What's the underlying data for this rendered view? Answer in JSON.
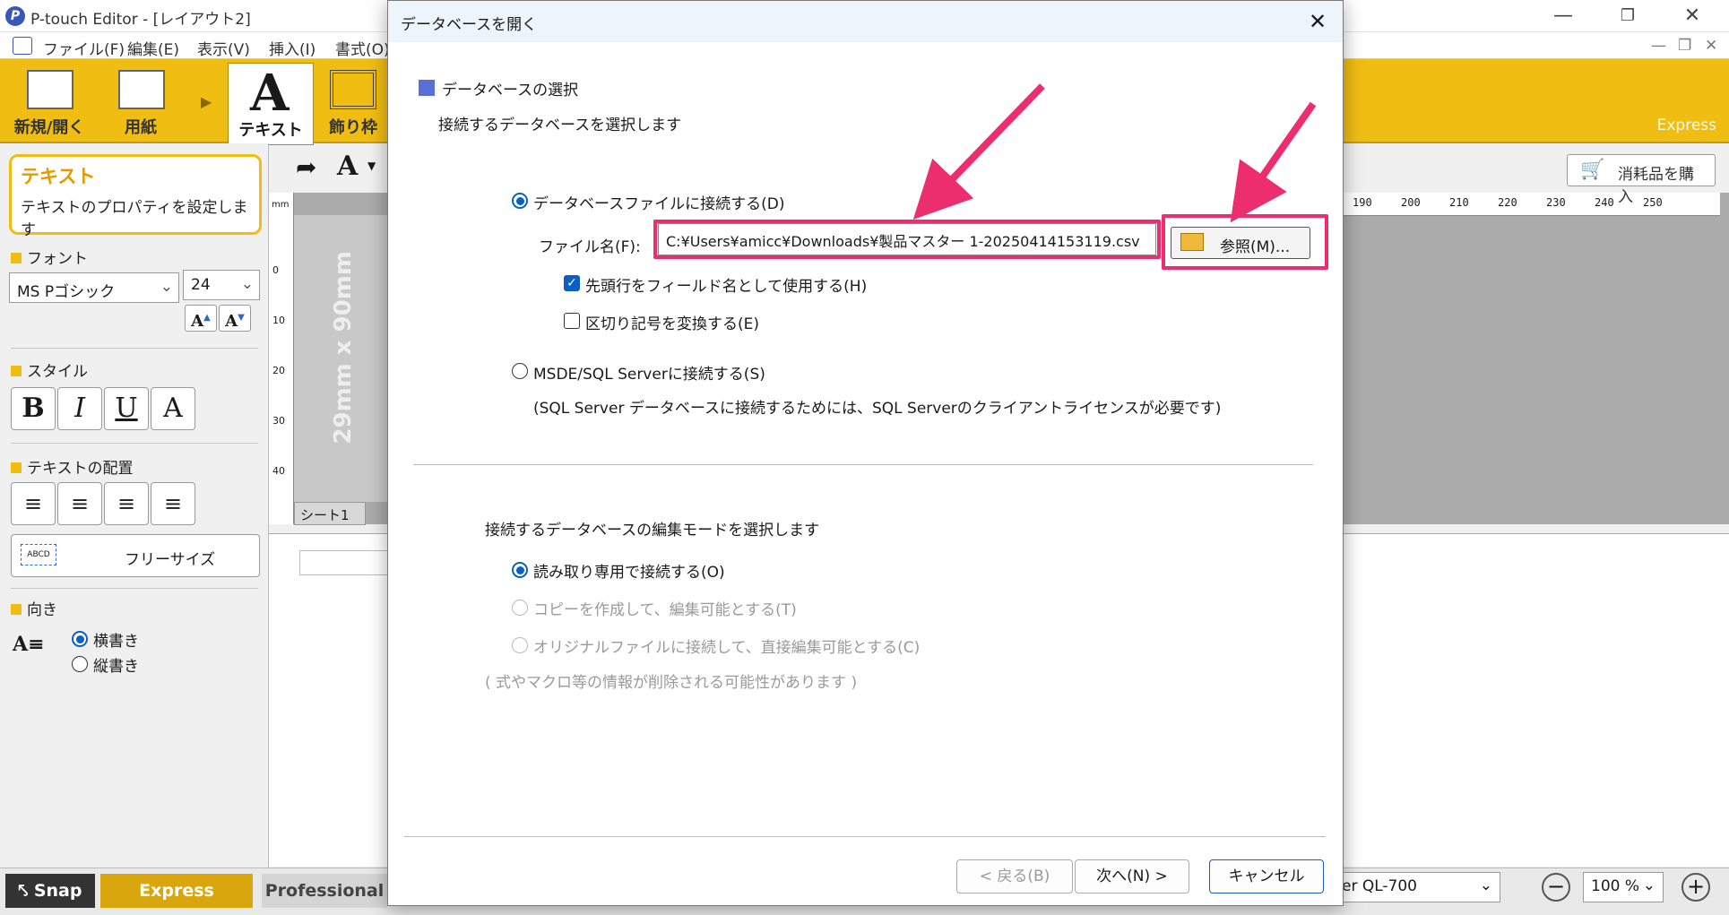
{
  "app": {
    "title": "P-touch Editor - [レイアウト2]",
    "logo": "P"
  },
  "menu": [
    "ファイル(F)",
    "編集(E)",
    "表示(V)",
    "挿入(I)",
    "書式(O)"
  ],
  "ribbon": {
    "new_open": "新規/開く",
    "paper": "用紙",
    "text": "テキスト",
    "frame": "飾り枠",
    "mode_label": "Express"
  },
  "left_panel": {
    "card_title": "テキスト",
    "card_desc": "テキストのプロパティを設定します",
    "font_section": "フォント",
    "font_name": "MS Pゴシック",
    "font_size": "24",
    "style_section": "スタイル",
    "align_section": "テキストの配置",
    "free_size": "フリーサイズ",
    "orientation_section": "向き",
    "horizontal": "横書き",
    "vertical": "縦書き"
  },
  "canvas": {
    "size_label": "29mm x 90mm",
    "sheet_tab": "シート1",
    "ruler_unit": "mm",
    "ruler_left_ticks": [
      "0",
      "10",
      "20",
      "30",
      "40"
    ],
    "ruler_top_ticks": [
      "190",
      "200",
      "210",
      "220",
      "230",
      "240",
      "250"
    ],
    "buy_label": "消耗品を購入"
  },
  "statusbar": {
    "snap": "Snap",
    "express": "Express",
    "professional": "Professional",
    "printer": "er QL-700",
    "zoom": "100 %"
  },
  "dialog": {
    "title": "データベースを開く",
    "section_title": "データベースの選択",
    "section_desc": "接続するデータベースを選択します",
    "opt_file": "データベースファイルに接続する(D)",
    "file_label": "ファイル名(F):",
    "file_value": "C:¥Users¥amicc¥Downloads¥製品マスター 1-20250414153119.csv",
    "browse_label": "参照(M)...",
    "chk_header": "先頭行をフィールド名として使用する(H)",
    "chk_delim": "区切り記号を変換する(E)",
    "opt_sql": "MSDE/SQL Serverに接続する(S)",
    "sql_note": "(SQL Server データベースに接続するためには、SQL Serverのクライアントライセンスが必要です)",
    "edit_mode_desc": "接続するデータベースの編集モードを選択します",
    "opt_readonly": "読み取り専用で接続する(O)",
    "opt_copy": "コピーを作成して、編集可能とする(T)",
    "opt_original": "オリジナルファイルに接続して、直接編集可能とする(C)",
    "macro_note": "( 式やマクロ等の情報が削除される可能性があります )",
    "back_btn": "< 戻る(B)",
    "next_btn": "次へ(N) >",
    "cancel_btn": "キャンセル"
  },
  "colors": {
    "ribbon": "#f0bd13",
    "highlight": "#ec2d6e",
    "radio_accent": "#0a5fc2",
    "section_square": "#5b6fd6"
  }
}
